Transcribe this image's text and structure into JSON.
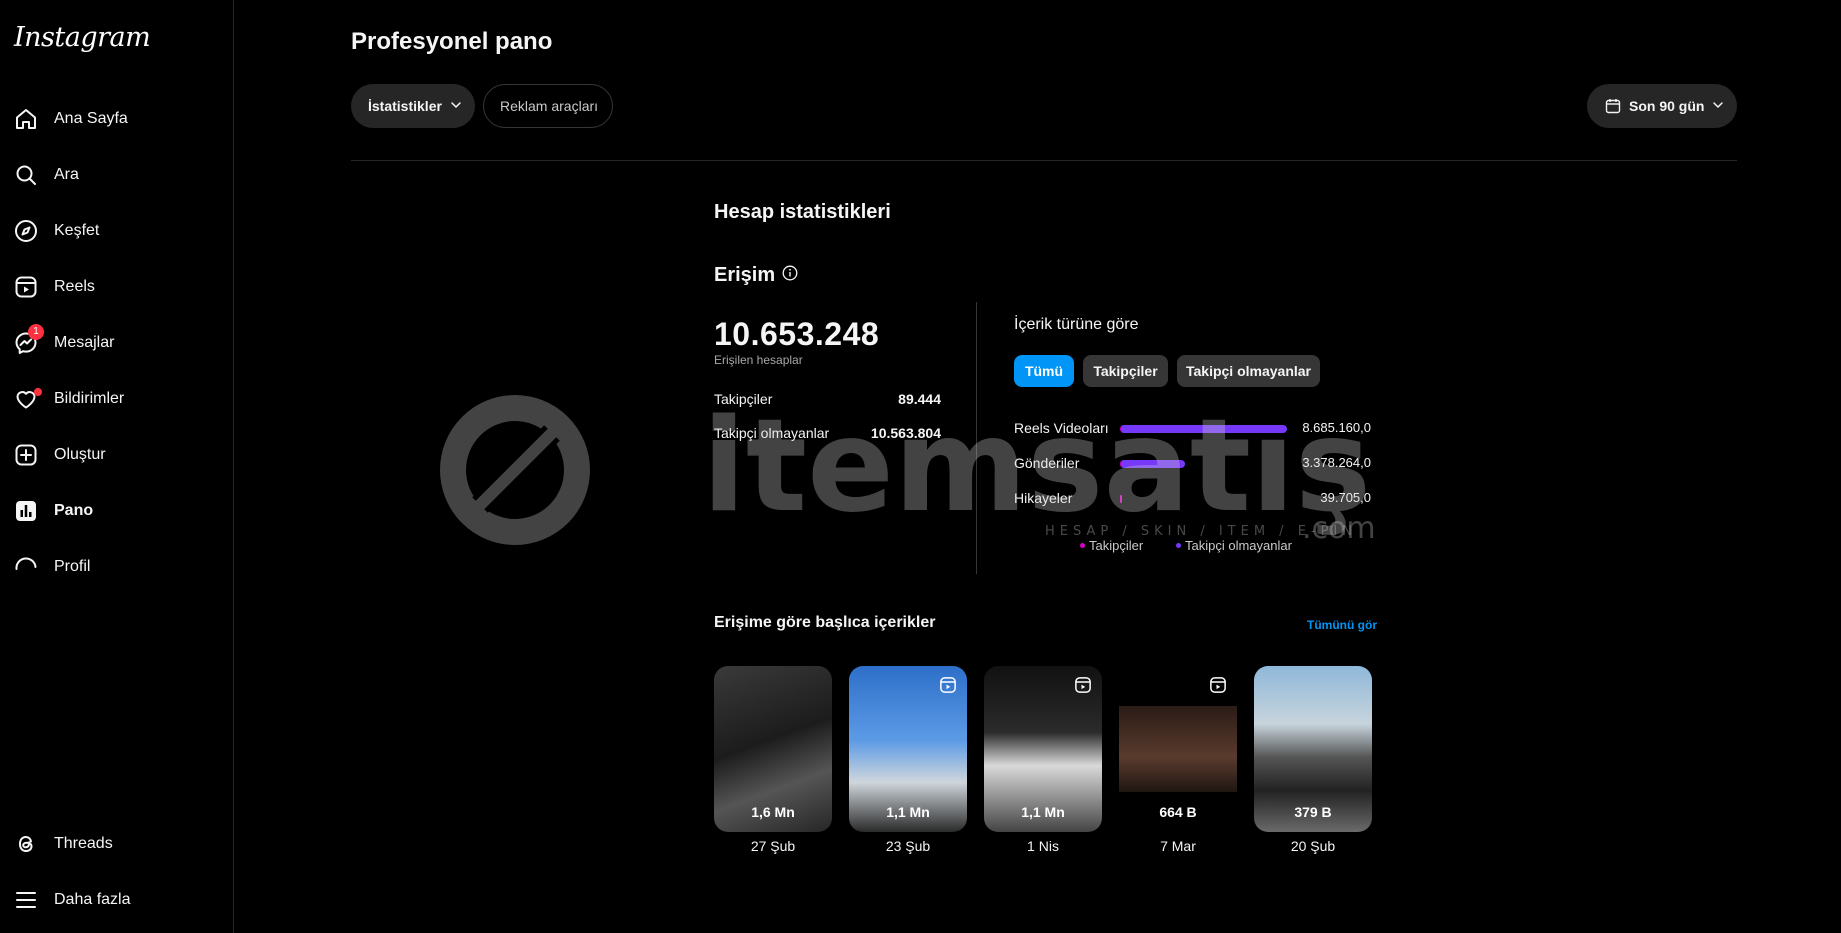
{
  "app": {
    "logo": "Instagram"
  },
  "sidebar": {
    "items": [
      {
        "label": "Ana Sayfa",
        "icon": "home-icon"
      },
      {
        "label": "Ara",
        "icon": "search-icon"
      },
      {
        "label": "Keşfet",
        "icon": "compass-icon"
      },
      {
        "label": "Reels",
        "icon": "reels-icon"
      },
      {
        "label": "Mesajlar",
        "icon": "messenger-icon",
        "badge": "1"
      },
      {
        "label": "Bildirimler",
        "icon": "heart-icon"
      },
      {
        "label": "Oluştur",
        "icon": "plus-square-icon"
      },
      {
        "label": "Pano",
        "icon": "dashboard-icon"
      },
      {
        "label": "Profil",
        "icon": "profile-avatar-icon"
      }
    ],
    "bottom": [
      {
        "label": "Threads",
        "icon": "threads-icon"
      },
      {
        "label": "Daha fazla",
        "icon": "menu-icon"
      }
    ]
  },
  "header": {
    "title": "Profesyonel pano",
    "tabs": {
      "stats": "İstatistikler",
      "ads": "Reklam araçları"
    },
    "date_range": "Son 90 gün"
  },
  "account_stats": {
    "title": "Hesap istatistikleri",
    "reach": {
      "title": "Erişim",
      "total": "10.653.248",
      "total_label": "Erişilen hesaplar",
      "rows": [
        {
          "label": "Takipçiler",
          "value": "89.444"
        },
        {
          "label": "Takipçi olmayanlar",
          "value": "10.563.804"
        }
      ]
    },
    "by_content": {
      "title": "İçerik türüne göre",
      "filters": [
        "Tümü",
        "Takipçiler",
        "Takipçi olmayanlar"
      ],
      "legend": [
        "Takipçiler",
        "Takipçi olmayanlar"
      ],
      "colors": {
        "followers": "#d300c5",
        "non_followers": "#7638fa"
      }
    }
  },
  "chart_data": {
    "type": "bar",
    "categories": [
      "Reels Videoları",
      "Gönderiler",
      "Hikayeler"
    ],
    "labels": [
      "8.685.160,0",
      "3.378.264,0",
      "39.705,0"
    ],
    "values": [
      8685160,
      3378264,
      39705
    ]
  },
  "top_content": {
    "title": "Erişime göre başlıca içerikler",
    "see_all": "Tümünü gör",
    "items": [
      {
        "value": "1,6 Mn",
        "date": "27 Şub",
        "reel": false
      },
      {
        "value": "1,1 Mn",
        "date": "23 Şub",
        "reel": true
      },
      {
        "value": "1,1 Mn",
        "date": "1 Nis",
        "reel": true
      },
      {
        "value": "664 B",
        "date": "7 Mar",
        "reel": true
      },
      {
        "value": "379 B",
        "date": "20 Şub",
        "reel": false
      }
    ]
  },
  "watermark": {
    "text": "itemsatış",
    "tagline": "HESAP / SKIN / ITEM / E-PIN",
    "suffix": ".com"
  }
}
